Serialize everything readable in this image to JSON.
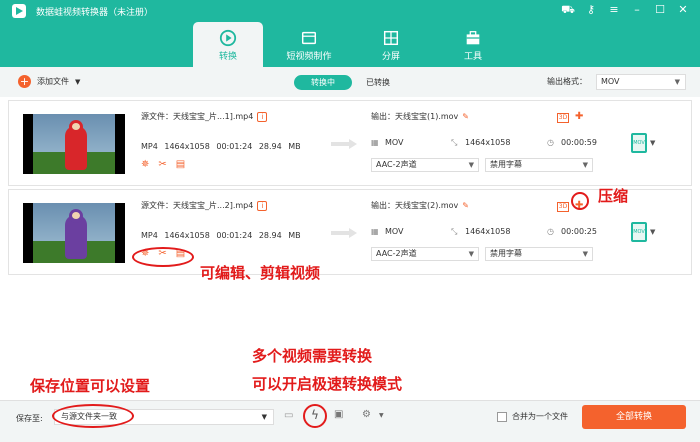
{
  "app": {
    "title": "数据蛙视频转换器（未注册）"
  },
  "main_tabs": [
    {
      "label": "转换",
      "icon": "convert-icon"
    },
    {
      "label": "短视频制作",
      "icon": "short-video-icon"
    },
    {
      "label": "分屏",
      "icon": "split-screen-icon"
    },
    {
      "label": "工具",
      "icon": "toolbox-icon"
    }
  ],
  "toolbar": {
    "add_file": "添加文件",
    "converting": "转换中",
    "converted": "已转换",
    "output_format_label": "输出格式：",
    "output_format_value": "MOV"
  },
  "files": [
    {
      "source_name": "源文件：天线宝宝_片...1].mp4",
      "source_meta": "MP4  1464x1058  00:01:24  28.94 MB",
      "output_name": "输出：天线宝宝(1).mov",
      "output_format": "MOV",
      "output_resolution": "1464x1058",
      "output_duration": "00:00:59",
      "audio": "AAC-2声道",
      "subtitle": "禁用字幕"
    },
    {
      "source_name": "源文件：天线宝宝_片...2].mp4",
      "source_meta": "MP4  1464x1058  00:01:24  28.94 MB",
      "output_name": "输出：天线宝宝(2).mov",
      "output_format": "MOV",
      "output_resolution": "1464x1058",
      "output_duration": "00:00:25",
      "audio": "AAC-2声道",
      "subtitle": "禁用字幕"
    }
  ],
  "bottom": {
    "save_label": "保存至:",
    "save_path": "与源文件夹一致",
    "merge_label": "合并为一个文件",
    "convert_all": "全部转换"
  },
  "annotations": {
    "compress": "压缩",
    "edit_clip": "可编辑、剪辑视频",
    "multi_1": "多个视频需要转换",
    "multi_2": "可以开启极速转换模式",
    "save_location": "保存位置可以设置"
  },
  "colors": {
    "accent": "#1fb89f",
    "orange": "#f4622d",
    "annotation": "#e21b1b"
  }
}
